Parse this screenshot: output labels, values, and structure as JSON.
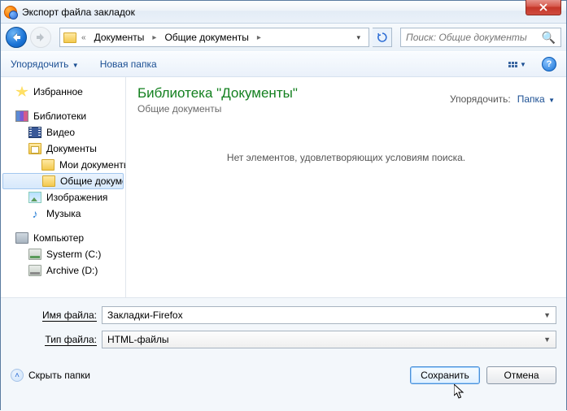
{
  "window": {
    "title": "Экспорт файла закладок"
  },
  "breadcrumb": {
    "item1": "Документы",
    "item2": "Общие документы"
  },
  "search": {
    "placeholder": "Поиск: Общие документы"
  },
  "toolbar": {
    "organize": "Упорядочить",
    "new_folder": "Новая папка"
  },
  "sidebar": {
    "favorites": "Избранное",
    "libraries": "Библиотеки",
    "video": "Видео",
    "documents": "Документы",
    "my_documents": "Мои документы",
    "public_documents": "Общие документы",
    "images": "Изображения",
    "music": "Музыка",
    "computer": "Компьютер",
    "drive_c": "Systerm (C:)",
    "drive_d": "Archive (D:)"
  },
  "content": {
    "lib_title": "Библиотека \"Документы\"",
    "lib_sub": "Общие документы",
    "sort_label": "Упорядочить:",
    "sort_value": "Папка",
    "empty": "Нет элементов, удовлетворяющих условиям поиска."
  },
  "fields": {
    "filename_label": "Имя файла:",
    "filename_value": "Закладки-Firefox",
    "filetype_label": "Тип файла:",
    "filetype_value": "HTML-файлы"
  },
  "buttons": {
    "hide_folders": "Скрыть папки",
    "save": "Сохранить",
    "cancel": "Отмена"
  }
}
